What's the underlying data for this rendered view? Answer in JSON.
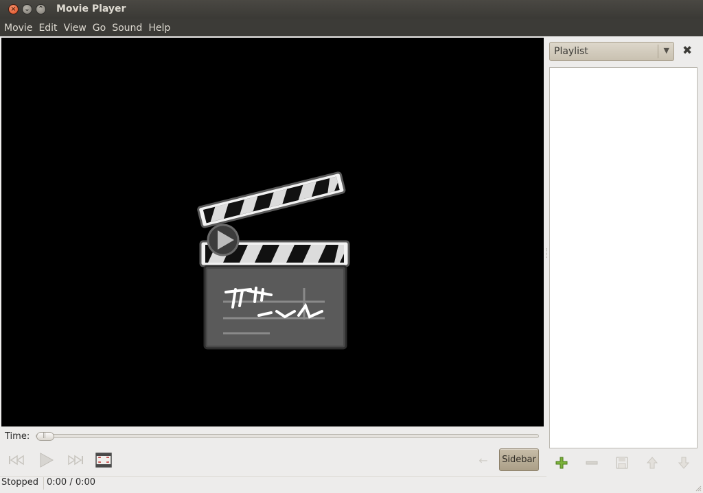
{
  "window": {
    "title": "Movie Player"
  },
  "menu": [
    "Movie",
    "Edit",
    "View",
    "Go",
    "Sound",
    "Help"
  ],
  "time_label": "Time:",
  "seek_position": 0,
  "controls": {
    "sidebar_label": "Sidebar"
  },
  "status": {
    "state": "Stopped",
    "time": "0:00 / 0:00"
  },
  "sidebar": {
    "dropdown_value": "Playlist"
  },
  "icons": {
    "logo": "clapperboard-icon",
    "previous": "skip-previous-icon",
    "play": "play-icon",
    "next": "skip-next-icon",
    "fullscreen": "fullscreen-icon",
    "add": "plus-icon",
    "remove": "minus-icon",
    "save": "save-icon",
    "up": "arrow-up-icon",
    "down": "arrow-down-icon"
  },
  "colors": {
    "titlebar": "#3c3b37",
    "sidebar_button": "#b8ad96",
    "add_icon": "#6ea22e"
  }
}
